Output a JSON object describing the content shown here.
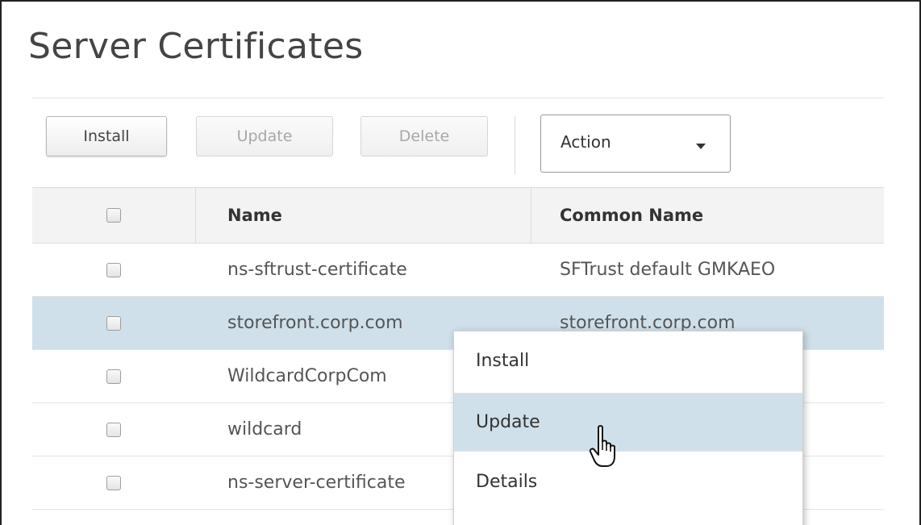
{
  "page": {
    "title": "Server Certificates"
  },
  "toolbar": {
    "install_label": "Install",
    "update_label": "Update",
    "delete_label": "Delete",
    "action_select": {
      "selected": "Action"
    }
  },
  "table": {
    "columns": {
      "name": "Name",
      "common_name": "Common Name"
    },
    "rows": [
      {
        "name": "ns-sftrust-certificate",
        "common_name": "SFTrust default GMKAEO"
      },
      {
        "name": "storefront.corp.com",
        "common_name": "storefront.corp.com"
      },
      {
        "name": "WildcardCorpCom",
        "common_name": ""
      },
      {
        "name": "wildcard",
        "common_name": ""
      },
      {
        "name": "ns-server-certificate",
        "common_name": ""
      }
    ]
  },
  "context_menu": {
    "items": [
      "Install",
      "Update",
      "Details"
    ]
  },
  "colors": {
    "selected_row": "#cfe0ea",
    "header_bg": "#f3f3f3"
  }
}
